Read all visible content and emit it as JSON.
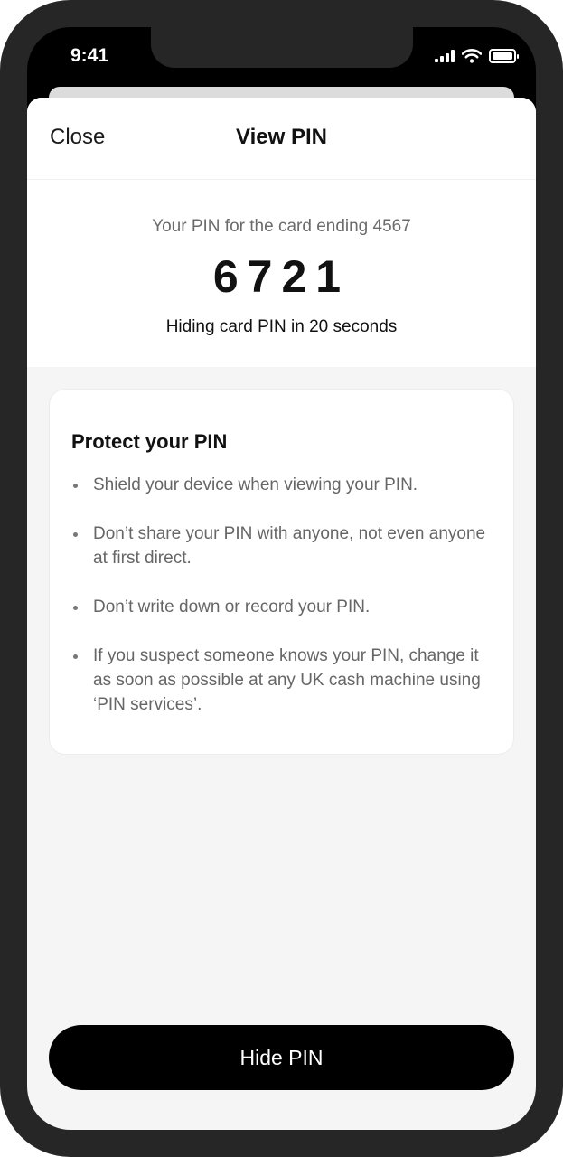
{
  "status_bar": {
    "time": "9:41",
    "icons": [
      "cellular-signal-icon",
      "wifi-icon",
      "battery-icon"
    ]
  },
  "header": {
    "close_label": "Close",
    "title": "View PIN"
  },
  "pin": {
    "caption": "Your PIN for the card ending 4567",
    "value": "6721",
    "timer_text": "Hiding card PIN in 20 seconds"
  },
  "protect": {
    "title": "Protect your PIN",
    "tips": [
      "Shield your device when viewing your PIN.",
      "Don’t share your PIN with anyone, not even anyone at first direct.",
      "Don’t write down or record your PIN.",
      "If you suspect someone knows your PIN, change it as soon as possible at any UK cash machine using ‘PIN services’."
    ]
  },
  "footer": {
    "hide_label": "Hide PIN"
  },
  "colors": {
    "background": "#f5f5f5",
    "button": "#000000",
    "text_primary": "#111111",
    "text_secondary": "#6b6b6b"
  }
}
